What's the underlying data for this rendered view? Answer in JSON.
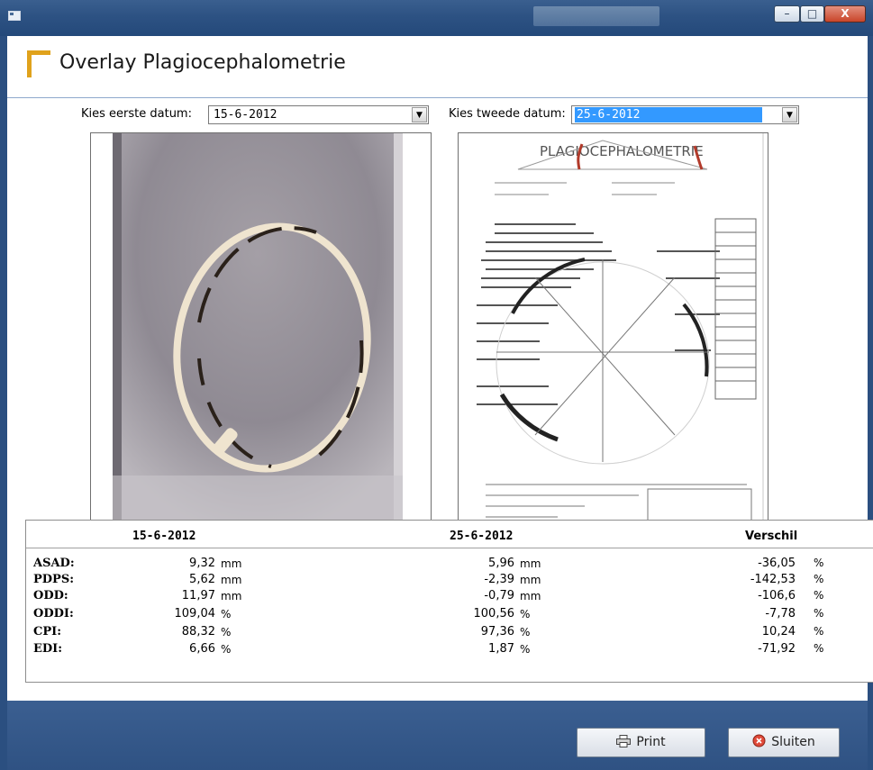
{
  "window": {
    "title": "Overlay Plagiocephalometrie",
    "controls": {
      "minimize": "–",
      "maximize": "□",
      "close": "X"
    }
  },
  "date_pickers": {
    "first": {
      "label": "Kies eerste datum:",
      "value": "15-6-2012"
    },
    "second": {
      "label": "Kies tweede datum:",
      "value": "25-6-2012"
    }
  },
  "second_scan": {
    "heading": "PLAGIOCEPHALOMETRIE"
  },
  "results": {
    "col_first": "15-6-2012",
    "col_second": "25-6-2012",
    "col_diff": "Verschil",
    "rows": [
      {
        "label": "ASAD:",
        "v1": "9,32",
        "u1": "mm",
        "v2": "5,96",
        "u2": "mm",
        "diff": "-36,05",
        "ud": "%"
      },
      {
        "label": "PDPS:",
        "v1": "5,62",
        "u1": "mm",
        "v2": "-2,39",
        "u2": "mm",
        "diff": "-142,53",
        "ud": "%"
      },
      {
        "label": "ODD:",
        "v1": "11,97",
        "u1": "mm",
        "v2": "-0,79",
        "u2": "mm",
        "diff": "-106,6",
        "ud": "%"
      },
      {
        "label": "ODDI:",
        "v1": "109,04",
        "u1": "%",
        "v2": "100,56",
        "u2": "%",
        "diff": "-7,78",
        "ud": "%"
      },
      {
        "label": "CPI:",
        "v1": "88,32",
        "u1": "%",
        "v2": "97,36",
        "u2": "%",
        "diff": "10,24",
        "ud": "%"
      },
      {
        "label": "EDI:",
        "v1": "6,66",
        "u1": "%",
        "v2": "1,87",
        "u2": "%",
        "diff": "-71,92",
        "ud": "%"
      }
    ]
  },
  "buttons": {
    "print": "Print",
    "close": "Sluiten"
  },
  "colors": {
    "frame": "#2b4f80",
    "selection": "#3399ff",
    "close_red": "#c9452a"
  }
}
